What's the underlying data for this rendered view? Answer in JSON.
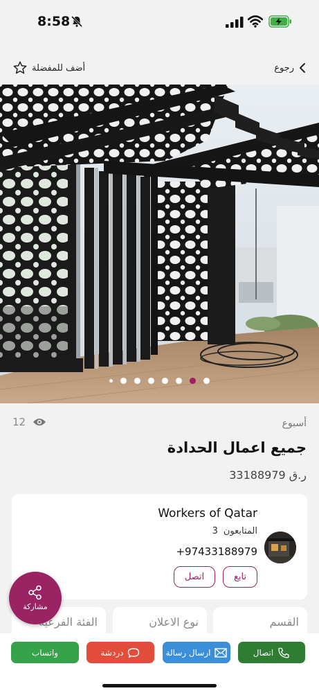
{
  "status_bar": {
    "time": "8:58"
  },
  "nav": {
    "back_label": "رجوع",
    "favorite_label": "أضف للمفضلة"
  },
  "gallery": {
    "image_description_icon": "pergola-photo",
    "total_slides": 7,
    "active_slide": 2
  },
  "listing": {
    "views": "12",
    "period": "أسبوع",
    "title": "جميع اعمال الحدادة",
    "price": "33188979 ر.ق"
  },
  "seller": {
    "name": "Workers of Qatar",
    "followers_label": "المتابعون",
    "followers_count": "3",
    "phone": "+97433188979",
    "follow_label": "تابع",
    "contact_label": "اتصل"
  },
  "details": {
    "section_label": "القسم",
    "ad_type_label": "نوع الاعلان",
    "subcategory_label": "الفئة الفرعية"
  },
  "share": {
    "label": "مشاركة"
  },
  "actions": {
    "call_label": "اتصال",
    "message_label": "ارسال رسالة",
    "chat_label": "دردشة",
    "whatsapp_label": "واتساب"
  },
  "colors": {
    "brand": "#9c1f62",
    "call": "#2e7d32",
    "message": "#3b8fd9",
    "chat": "#e24d3c",
    "whatsapp": "#36a34a"
  }
}
